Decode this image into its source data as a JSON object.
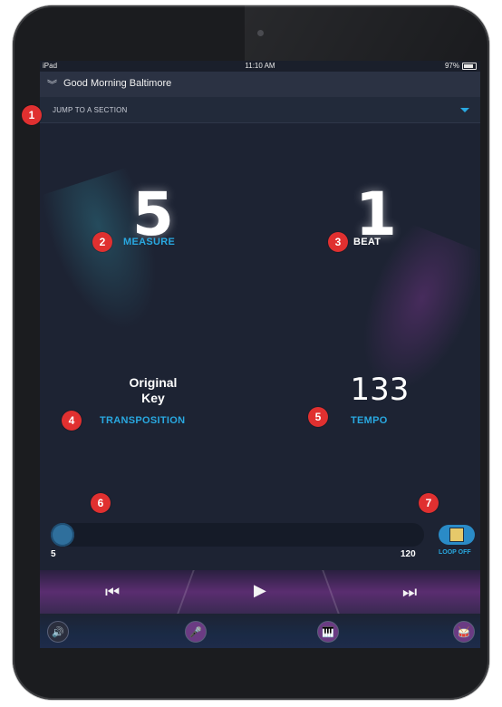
{
  "status": {
    "carrier": "iPad",
    "time": "11:10 AM",
    "battery": "97%"
  },
  "title": {
    "song": "Good Morning Baltimore"
  },
  "section": {
    "placeholder": "JUMP TO A SECTION"
  },
  "measure": {
    "value": "5",
    "label": "MEASURE"
  },
  "beat": {
    "value": "1",
    "label": "BEAT"
  },
  "key": {
    "text_line1": "Original",
    "text_line2": "Key",
    "label": "TRANSPOSITION"
  },
  "tempo": {
    "value": "133",
    "label": "TEMPO"
  },
  "slider": {
    "min_label": "5",
    "max_label": "120"
  },
  "loop": {
    "label": "LOOP OFF"
  },
  "badges": [
    "1",
    "2",
    "3",
    "4",
    "5",
    "6",
    "7"
  ],
  "colors": {
    "accent": "#29a8e0",
    "badge": "#e03030",
    "background": "#1d2333"
  },
  "icons": {
    "prev": "skip-previous-icon",
    "play": "play-icon",
    "next": "skip-next-icon",
    "tool1": "speaker-icon",
    "tool2": "microphone-icon",
    "tool3": "piano-icon",
    "tool4": "drum-icon"
  }
}
